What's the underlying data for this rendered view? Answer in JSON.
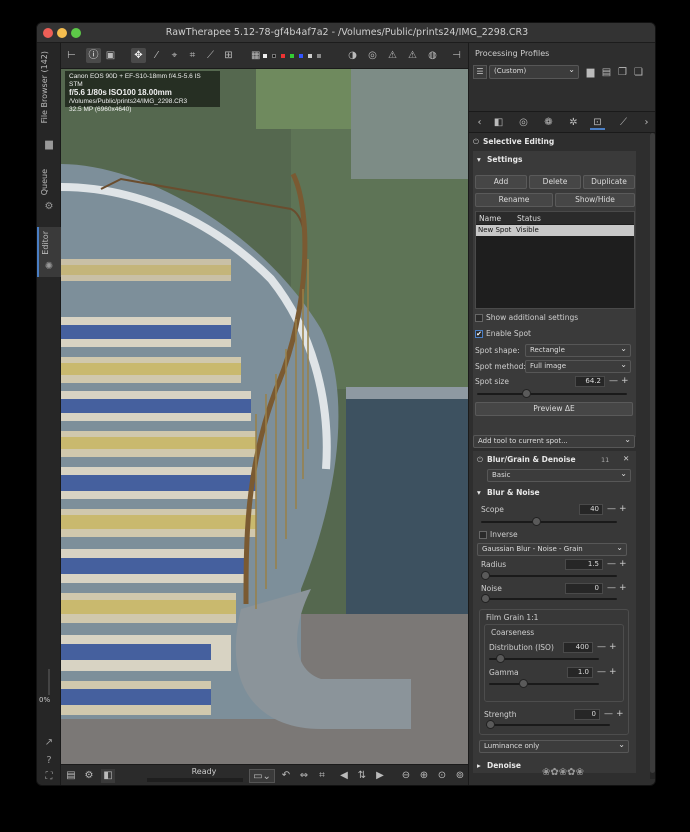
{
  "window": {
    "title": "RawTherapee 5.12-78-gf4b4af7a2 - /Volumes/Public/prints24/IMG_2298.CR3"
  },
  "left_tabs": {
    "file_browser": "File Browser (142)",
    "queue": "Queue",
    "editor": "Editor",
    "zoom_percent": "0%"
  },
  "exif": {
    "line1": "Canon EOS 90D + EF-S10-18mm f/4.5-5.6 IS STM",
    "f": "f/5.6",
    "shutter": "1/80s",
    "iso": "ISO100",
    "focal": "18.00mm",
    "path": "/Volumes/Public/prints24/IMG_2298.CR3",
    "mp": "32.5 MP (6960x4640)"
  },
  "status": {
    "text": "Ready"
  },
  "panel": {
    "processing_profiles": "Processing Profiles",
    "profile_value": "(Custom)",
    "selective_editing": "Selective Editing",
    "settings": "Settings",
    "buttons": {
      "add": "Add",
      "delete": "Delete",
      "duplicate": "Duplicate",
      "rename": "Rename",
      "show_hide": "Show/Hide"
    },
    "spot_table": {
      "headers": [
        "Name",
        "Status"
      ],
      "rows": [
        {
          "name": "New Spot",
          "status": "Visible"
        }
      ]
    },
    "show_additional": "Show additional settings",
    "enable_spot": "Enable Spot",
    "spot_shape_label": "Spot shape:",
    "spot_shape_value": "Rectangle",
    "spot_method_label": "Spot method:",
    "spot_method_value": "Full image",
    "spot_size_label": "Spot size",
    "spot_size_value": "64.2",
    "spot_size_fraction": 0.32,
    "preview_de": "Preview ΔE",
    "add_tool": "Add tool to current spot...",
    "blur_title": "Blur/Grain & Denoise",
    "blur_badge": "11",
    "complexity": "Basic",
    "blur_noise": "Blur & Noise",
    "scope_label": "Scope",
    "scope_value": "40",
    "scope_fraction": 0.4,
    "inverse": "Inverse",
    "blur_method": "Gaussian Blur - Noise - Grain",
    "radius_label": "Radius",
    "radius_value": "1.5",
    "radius_fraction": 0.0,
    "noise_label": "Noise",
    "noise_value": "0",
    "noise_fraction": 0.0,
    "film_grain": "Film Grain 1:1",
    "coarseness": "Coarseness",
    "distribution_label": "Distribution (ISO)",
    "distribution_value": "400",
    "distribution_fraction": 0.07,
    "gamma_label": "Gamma",
    "gamma_value": "1.0",
    "gamma_fraction": 0.3,
    "strength_label": "Strength",
    "strength_value": "0",
    "strength_fraction": 0.0,
    "luminance": "Luminance only",
    "denoise": "Denoise"
  },
  "colors": {
    "accent": "#4a7ec4",
    "selected_row": "#c8c8c8"
  }
}
